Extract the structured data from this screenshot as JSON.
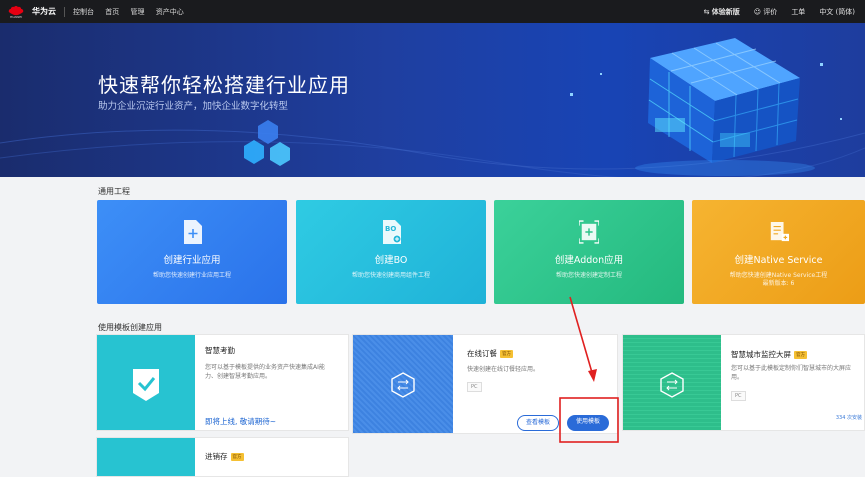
{
  "topbar": {
    "logo_text": "HUAWEI",
    "brand": "华为云",
    "nav": [
      "控制台",
      "首页",
      "管理",
      "资产中心"
    ],
    "experience": "体验新版",
    "feedback": "评价",
    "workorder": "工单",
    "language": "中文 (简体)"
  },
  "hero": {
    "title": "快速帮你轻松搭建行业应用",
    "subtitle": "助力企业沉淀行业资产，加快企业数字化转型"
  },
  "section_general": "通用工程",
  "cards": [
    {
      "title": "创建行业应用",
      "desc": "帮助您快速创建行业应用工程",
      "color": "#2f80f2"
    },
    {
      "title": "创建BO",
      "desc": "帮助您快速创建商用组件工程",
      "color": "#25b8d9"
    },
    {
      "title": "创建Addon应用",
      "desc": "帮助您快速创建定制工程",
      "color": "#2ec28a"
    },
    {
      "title": "创建Native Service",
      "desc": "帮助您快速创建Native Service工程",
      "desc2": "最新版本: 6",
      "color": "#f0a822"
    }
  ],
  "section_template": "使用模板创建应用",
  "templates": {
    "t1": {
      "title": "智慧考勤",
      "desc1": "您可以基于模板提供的业务资产快速集成AI能",
      "desc2": "力、创建智慧考勤应用。",
      "link": "即将上线, 敬请期待~"
    },
    "t2": {
      "title": "在线订餐",
      "badge": "官方",
      "desc": "快速创建在线订餐轻应用。",
      "tag": "PC",
      "view": "查看模板",
      "use": "使用模板"
    },
    "t3": {
      "title": "智慧城市监控大屏",
      "badge": "官方",
      "desc1": "您可以基于此模板定制你们智慧城市的大屏应",
      "desc2": "用。",
      "tag": "PC",
      "stat": "334 次安装"
    },
    "t4": {
      "title": "进销存",
      "badge": "官方"
    }
  }
}
